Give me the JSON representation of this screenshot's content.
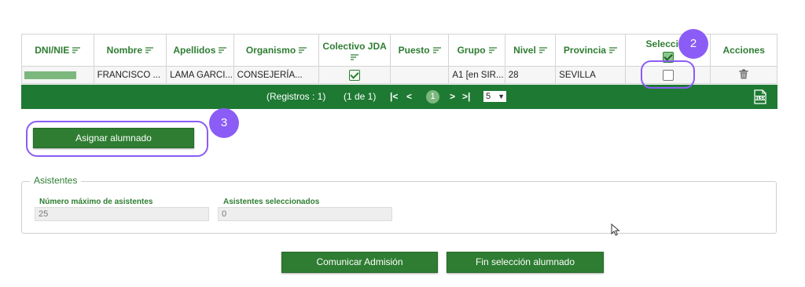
{
  "table": {
    "columns": [
      {
        "label": "DNI/NIE",
        "sortable": true
      },
      {
        "label": "Nombre",
        "sortable": true
      },
      {
        "label": "Apellidos",
        "sortable": true
      },
      {
        "label": "Organismo",
        "sortable": true
      },
      {
        "label": "Colectivo JDA",
        "sortable": true
      },
      {
        "label": "Puesto",
        "sortable": true
      },
      {
        "label": "Grupo",
        "sortable": true
      },
      {
        "label": "Nivel",
        "sortable": true
      },
      {
        "label": "Provincia",
        "sortable": true
      },
      {
        "label": "Seleccion",
        "sortable": false,
        "select_all_checked": true
      },
      {
        "label": "Acciones",
        "sortable": false
      }
    ],
    "rows": [
      {
        "nombre": "FRANCISCO ...",
        "apellidos": "LAMA GARCI...",
        "organismo": "CONSEJERÍA...",
        "colectivo_jda_checked": true,
        "puesto": "",
        "grupo": "A1 [en SIR...",
        "nivel": "28",
        "provincia": "SEVILLA",
        "selected": false,
        "action_icon": "trash-icon"
      }
    ]
  },
  "pager": {
    "records": "(Registros : 1)",
    "page_info": "(1 de 1)",
    "first": "|<",
    "prev": "<",
    "current_page": "1",
    "next": ">",
    "last": ">|",
    "page_size": "5",
    "export_icon": "xlsx-export-icon"
  },
  "annotations": {
    "step2": "2",
    "step3": "3"
  },
  "assign_button": "Asignar alumnado",
  "asistentes": {
    "legend": "Asistentes",
    "max_label": "Número máximo de asistentes",
    "max_value": "25",
    "selected_label": "Asistentes seleccionados",
    "selected_value": "0"
  },
  "footer": {
    "comunicar": "Comunicar Admisión",
    "fin": "Fin selección alumnado"
  },
  "colors": {
    "brand_green": "#2e7d32",
    "pager_green": "#1e7a33",
    "annotation_purple": "#8b5cf6"
  }
}
